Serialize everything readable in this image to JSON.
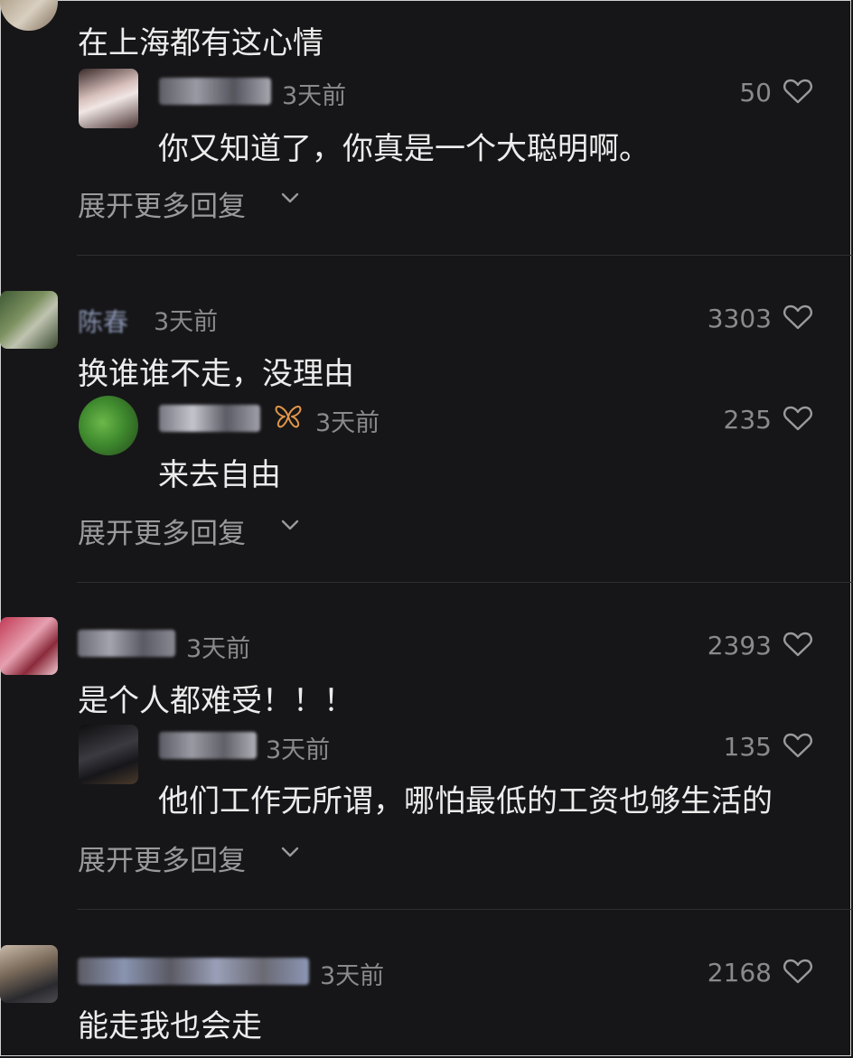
{
  "threads": [
    {
      "main": {
        "name": "",
        "time": "",
        "likes": "",
        "text": "在上海都有这心情"
      },
      "reply": {
        "name": "",
        "time": "3天前",
        "likes": "50",
        "text": "你又知道了，你真是一个大聪明啊。"
      },
      "expand_label": "展开更多回复"
    },
    {
      "main": {
        "name": "陈春",
        "time": "3天前",
        "likes": "3303",
        "text": "换谁谁不走，没理由"
      },
      "reply": {
        "name": "",
        "time": "3天前",
        "likes": "235",
        "text": "来去自由",
        "badge": "butterfly-badge"
      },
      "expand_label": "展开更多回复"
    },
    {
      "main": {
        "name": "",
        "time": "3天前",
        "likes": "2393",
        "text": "是个人都难受！！！"
      },
      "reply": {
        "name": "",
        "time": "3天前",
        "likes": "135",
        "text": "他们工作无所谓，哪怕最低的工资也够生活的"
      },
      "expand_label": "展开更多回复"
    },
    {
      "main": {
        "name": "",
        "time": "3天前",
        "likes": "2168",
        "text": "能走我也会走"
      }
    }
  ],
  "icons": {
    "like": "heart-outline-icon",
    "expand": "chevron-down-icon",
    "badge": "butterfly-icon"
  },
  "colors": {
    "background": "#161618",
    "text": "#ececec",
    "muted": "#8a8a8e",
    "badge": "#e2954a"
  }
}
